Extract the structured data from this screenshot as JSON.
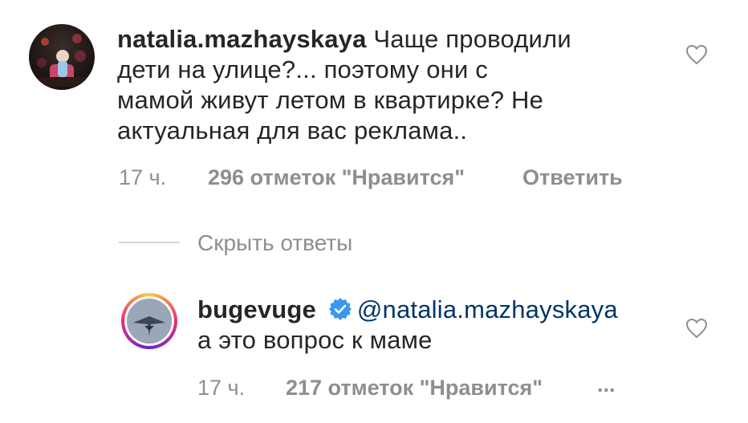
{
  "comment": {
    "username": "natalia.mazhayskaya",
    "text_line1": "Чаще проводили",
    "text_line2": "дети на улице?... поэтому они с",
    "text_line3": "мамой живут летом в квартирке?  Не",
    "text_line4": "актуальная для вас реклама..",
    "time": "17 ч.",
    "likes": "296 отметок \"Нравится\"",
    "reply_label": "Ответить"
  },
  "replies_toggle": {
    "label": "Скрыть ответы"
  },
  "reply": {
    "username": "bugevuge",
    "mention": "@natalia.mazhayskaya",
    "text": "а это вопрос к маме",
    "time": "17 ч.",
    "likes": "217 отметок \"Нравится\"",
    "more": "..."
  },
  "icons": {
    "like": "heart-outline-icon",
    "verified": "verified-badge-icon"
  },
  "colors": {
    "text": "#262626",
    "secondary": "#8e8e8e",
    "link": "#003569",
    "verified": "#3897f0"
  }
}
